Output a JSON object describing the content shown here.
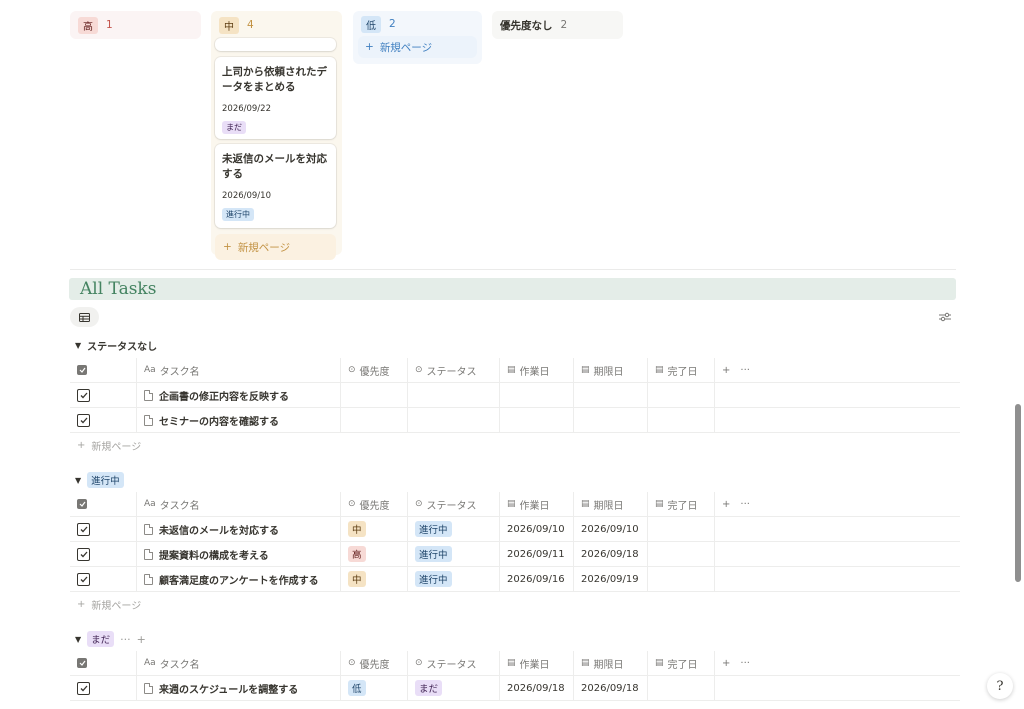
{
  "board": {
    "columns": [
      {
        "label": "高",
        "count": "1"
      },
      {
        "label": "中",
        "count": "4"
      },
      {
        "label": "低",
        "count": "2"
      },
      {
        "label": "優先度なし",
        "count": "2"
      }
    ],
    "mid_cards": [
      {
        "title": "上司から依頼されたデータをまとめる",
        "date": "2026/09/22",
        "tag": "まだ"
      },
      {
        "title": "未返信のメールを対応する",
        "date": "2026/09/10",
        "tag": "進行中"
      }
    ],
    "new_page": "新規ページ"
  },
  "section": {
    "title": "All Tasks"
  },
  "columns": {
    "name": "タスク名",
    "priority": "優先度",
    "status": "ステータス",
    "work_date": "作業日",
    "due_date": "期限日",
    "done_date": "完了日",
    "name_icon": "Aa",
    "add": "+",
    "more": "···"
  },
  "groups": {
    "none": {
      "title": "ステータスなし",
      "rows": [
        {
          "name": "企画書の修正内容を反映する"
        },
        {
          "name": "セミナーの内容を確認する"
        }
      ]
    },
    "progress": {
      "title": "進行中",
      "rows": [
        {
          "name": "未返信のメールを対応する",
          "priority": "中",
          "status": "進行中",
          "work": "2026/09/10",
          "due": "2026/09/10"
        },
        {
          "name": "提案資料の構成を考える",
          "priority": "高",
          "status": "進行中",
          "work": "2026/09/11",
          "due": "2026/09/18"
        },
        {
          "name": "顧客満足度のアンケートを作成する",
          "priority": "中",
          "status": "進行中",
          "work": "2026/09/16",
          "due": "2026/09/19"
        }
      ]
    },
    "notyet": {
      "title": "まだ",
      "more": "···",
      "add": "+",
      "rows": [
        {
          "name": "来週のスケジュールを調整する",
          "priority": "低",
          "status": "まだ",
          "work": "2026/09/18",
          "due": "2026/09/18"
        }
      ]
    }
  },
  "new_page": "新規ページ",
  "help": "?",
  "colors": {
    "heading_bg": "#e4ede8",
    "heading_text": "#448361",
    "high": "#f7dad6",
    "mid": "#f5e3c4",
    "low": "#d4e6f7",
    "purple": "#e9def7"
  }
}
